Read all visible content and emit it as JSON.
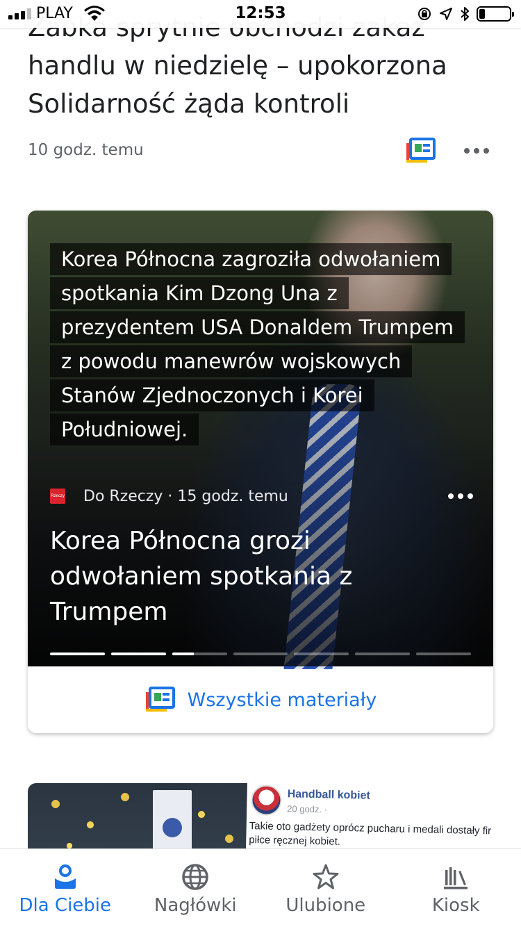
{
  "status_bar": {
    "carrier": "PLAY",
    "time": "12:53",
    "battery_level": 0.2,
    "icons": [
      "signal-icon",
      "wifi-icon",
      "orientation-lock-icon",
      "location-icon",
      "bluetooth-icon",
      "battery-icon"
    ]
  },
  "top_story": {
    "title": "Żabka sprytnie obchodzi zakaz handlu w niedzielę – upokorzona Solidarność żąda kontroli",
    "time": "10 godz. temu"
  },
  "feature_card": {
    "snippet": "Korea Północna zagroziła odwołaniem spotkania Kim Dzong Una z prezydentem USA Donaldem Trumpem z powodu manewrów wojskowych Stanów Zjednoczonych i Korei Południowej.",
    "source": "Do Rzeczy",
    "separator": " · ",
    "time": "15 godz. temu",
    "source_logo_text": "Rzeczy",
    "headline": "Korea Północna grozi odwołaniem spotkania z Trumpem",
    "progress": [
      1,
      1,
      0.4,
      0,
      0,
      0,
      0
    ],
    "footer_label": "Wszystkie materiały"
  },
  "next_card": {
    "page_name": "Handball kobiet",
    "time": "20 godz. · ",
    "text": "Takie oto gadżety oprócz pucharu i medali dostały fir piłce ręcznej kobiet."
  },
  "bottom_nav": {
    "items": [
      {
        "label": "Dla Ciebie",
        "icon": "for-you-icon",
        "active": true
      },
      {
        "label": "Nagłówki",
        "icon": "globe-icon",
        "active": false
      },
      {
        "label": "Ulubione",
        "icon": "star-icon",
        "active": false
      },
      {
        "label": "Kiosk",
        "icon": "newsstand-icon",
        "active": false
      }
    ]
  },
  "colors": {
    "accent": "#1a73e8",
    "text_primary": "#202124",
    "text_secondary": "#5f6368"
  }
}
